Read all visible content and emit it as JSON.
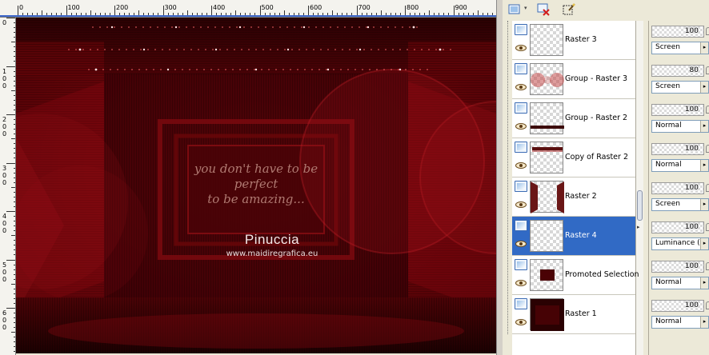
{
  "colors": {
    "accent": "#316ac5",
    "ruler_guide": "#3a64c8",
    "canvas_base": "#3a0204",
    "canvas_red": "#8a0a10"
  },
  "ruler": {
    "top_labels": [
      "0",
      "100",
      "200",
      "300",
      "400",
      "500",
      "600",
      "700",
      "800",
      "900"
    ],
    "left_labels": [
      [
        "0"
      ],
      [
        "1",
        "0",
        "0"
      ],
      [
        "2",
        "0",
        "0"
      ],
      [
        "3",
        "0",
        "0"
      ],
      [
        "4",
        "0",
        "0"
      ],
      [
        "5",
        "0",
        "0"
      ],
      [
        "6",
        "0",
        "0"
      ]
    ]
  },
  "canvas": {
    "quote_line1": "you don't have to be",
    "quote_line2": "perfect",
    "quote_line3": "to be amazing...",
    "signature": "Pinuccia",
    "website": "www.maidiregrafica.eu"
  },
  "toolbar": {
    "icons": [
      "new-raster-layer-icon",
      "delete-layer-icon",
      "edit-selection-icon"
    ]
  },
  "layers": [
    {
      "name": "Raster 3",
      "opacity": "100",
      "blend": "Screen",
      "thumb": "transparent",
      "selected": false
    },
    {
      "name": "Group - Raster 3",
      "opacity": "80",
      "blend": "Screen",
      "thumb": "circles",
      "selected": false
    },
    {
      "name": "Group - Raster 2",
      "opacity": "100",
      "blend": "Normal",
      "thumb": "bar-bottom",
      "selected": false
    },
    {
      "name": "Copy of Raster 2",
      "opacity": "100",
      "blend": "Normal",
      "thumb": "bar-top",
      "selected": false
    },
    {
      "name": "Raster 2",
      "opacity": "100",
      "blend": "Screen",
      "thumb": "sides",
      "selected": false
    },
    {
      "name": "Raster 4",
      "opacity": "100",
      "blend": "Luminance (L)",
      "thumb": "transparent",
      "selected": true
    },
    {
      "name": "Promoted Selection",
      "opacity": "100",
      "blend": "Normal",
      "thumb": "center-rect",
      "selected": false
    },
    {
      "name": "Raster 1",
      "opacity": "100",
      "blend": "Normal",
      "thumb": "dark",
      "selected": false
    }
  ]
}
